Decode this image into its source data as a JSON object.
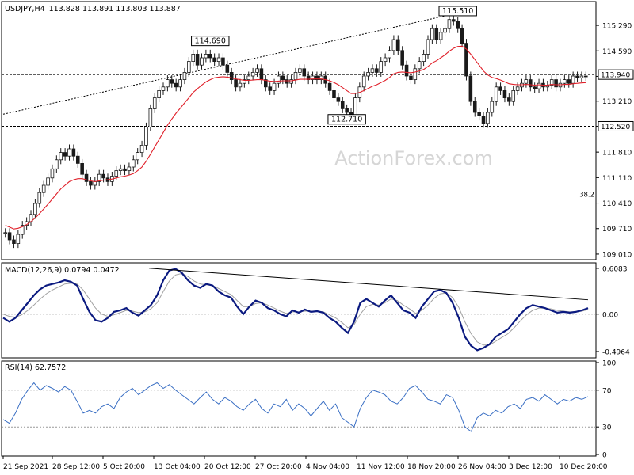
{
  "header": {
    "symbol": "USDJPY,H4",
    "ohlc": "113.828 113.891 113.803 113.887"
  },
  "watermark": "ActionForex.com",
  "colors": {
    "candle": "#1a1a1a",
    "ma": "#e0202a",
    "macd": "#0b1a80",
    "signal": "#a0a0a0",
    "rsi": "#3a6fc4",
    "levels": "#000000",
    "watermark": "#d8d8d8"
  },
  "chart_data": [
    {
      "type": "candlestick",
      "panel": "price",
      "title": "USDJPY,H4",
      "ylim": [
        108.9,
        115.9
      ],
      "y_ticks": [
        "115.290",
        "114.590",
        "113.890",
        "113.210",
        "112.520",
        "111.810",
        "111.110",
        "110.410",
        "109.710",
        "109.010"
      ],
      "y_tick_values": [
        115.29,
        114.59,
        113.89,
        113.21,
        112.52,
        111.81,
        111.11,
        110.41,
        109.71,
        109.01
      ],
      "x_ticks": [
        "21 Sep 2021",
        "28 Sep 12:00",
        "5 Oct 20:00",
        "13 Oct 04:00",
        "20 Oct 12:00",
        "27 Oct 20:00",
        "4 Nov 04:00",
        "11 Nov 12:00",
        "18 Nov 20:00",
        "26 Nov 04:00",
        "3 Dec 12:00",
        "10 Dec 20:00"
      ],
      "close_series": [
        109.6,
        109.4,
        109.3,
        109.55,
        109.8,
        109.9,
        110.1,
        110.4,
        110.7,
        110.9,
        111.1,
        111.35,
        111.6,
        111.8,
        111.7,
        111.9,
        111.7,
        111.5,
        111.2,
        111.0,
        110.9,
        111.0,
        111.2,
        111.1,
        111.0,
        111.15,
        111.3,
        111.35,
        111.3,
        111.4,
        111.6,
        111.8,
        112.0,
        112.5,
        113.0,
        113.3,
        113.5,
        113.6,
        113.8,
        113.7,
        113.6,
        113.8,
        114.0,
        114.3,
        114.5,
        114.2,
        114.4,
        114.5,
        114.4,
        114.3,
        114.4,
        114.2,
        114.0,
        113.8,
        113.6,
        113.7,
        113.8,
        113.9,
        114.0,
        114.1,
        113.8,
        113.6,
        113.5,
        113.7,
        113.9,
        113.8,
        113.7,
        113.8,
        114.0,
        114.1,
        113.9,
        113.8,
        113.9,
        113.8,
        113.9,
        113.7,
        113.5,
        113.3,
        113.2,
        113.0,
        112.9,
        112.75,
        113.3,
        113.6,
        113.9,
        114.0,
        114.1,
        114.0,
        114.3,
        114.4,
        114.6,
        114.9,
        114.6,
        114.2,
        113.9,
        113.8,
        114.1,
        114.3,
        114.5,
        114.9,
        115.2,
        114.9,
        115.1,
        115.2,
        115.45,
        115.4,
        115.2,
        114.8,
        113.9,
        113.2,
        112.9,
        112.8,
        112.6,
        112.9,
        113.2,
        113.6,
        113.5,
        113.3,
        113.2,
        113.5,
        113.6,
        113.7,
        113.8,
        113.6,
        113.55,
        113.7,
        113.6,
        113.65,
        113.8,
        113.6,
        113.7,
        113.8,
        113.7,
        113.9,
        113.85,
        113.9,
        113.887
      ],
      "high_points": [
        {
          "x": "13 Oct 04:00",
          "value": 114.69
        },
        {
          "x": "22 Nov",
          "value": 115.51
        }
      ],
      "low_point": {
        "x": "4 Nov 04:00",
        "value": 112.71
      },
      "moving_average": [
        109.8,
        109.75,
        109.7,
        109.72,
        109.76,
        109.82,
        109.9,
        110.0,
        110.12,
        110.25,
        110.38,
        110.52,
        110.66,
        110.8,
        110.9,
        111.0,
        111.05,
        111.08,
        111.08,
        111.05,
        111.02,
        111.0,
        111.02,
        111.04,
        111.05,
        111.07,
        111.1,
        111.13,
        111.15,
        111.18,
        111.22,
        111.3,
        111.4,
        111.56,
        111.75,
        111.95,
        112.15,
        112.35,
        112.55,
        112.72,
        112.88,
        113.02,
        113.16,
        113.3,
        113.45,
        113.55,
        113.65,
        113.74,
        113.8,
        113.85,
        113.87,
        113.88,
        113.87,
        113.85,
        113.82,
        113.8,
        113.78,
        113.78,
        113.79,
        113.8,
        113.8,
        113.78,
        113.76,
        113.75,
        113.76,
        113.77,
        113.77,
        113.77,
        113.79,
        113.81,
        113.81,
        113.81,
        113.82,
        113.82,
        113.82,
        113.8,
        113.77,
        113.72,
        113.66,
        113.58,
        113.5,
        113.42,
        113.42,
        113.45,
        113.5,
        113.56,
        113.62,
        113.66,
        113.72,
        113.78,
        113.86,
        113.96,
        114.0,
        114.01,
        114.0,
        113.99,
        114.01,
        114.04,
        114.08,
        114.16,
        114.26,
        114.32,
        114.4,
        114.48,
        114.58,
        114.66,
        114.71,
        114.72,
        114.64,
        114.5,
        114.35,
        114.2,
        114.04,
        113.93,
        113.86,
        113.83,
        113.79,
        113.74,
        113.69,
        113.67,
        113.66,
        113.66,
        113.67,
        113.66,
        113.65,
        113.66,
        113.65,
        113.65,
        113.67,
        113.66,
        113.66,
        113.67,
        113.67,
        113.69,
        113.7,
        113.71,
        113.72
      ],
      "horizontal_levels": [
        {
          "value": 113.94,
          "label": "113.940",
          "style": "dashed"
        },
        {
          "value": 112.52,
          "label": "112.520",
          "style": "dashed"
        },
        {
          "value": 110.52,
          "label": "38.2",
          "style": "solid"
        }
      ],
      "trendline": {
        "from": {
          "x": "21 Sep 2021",
          "value": 112.85
        },
        "to": {
          "x": "23 Nov",
          "value": 115.55
        },
        "style": "dotted"
      },
      "labels": [
        "114.690",
        "115.510",
        "112.710",
        "113.940",
        "112.520",
        "38.2"
      ]
    },
    {
      "type": "line",
      "panel": "macd",
      "title": "MACD(12,26,9) 0.0794 0.0472",
      "ylim": [
        -0.56,
        0.66
      ],
      "y_ticks": [
        "0.6083",
        "0.00",
        "-0.4964"
      ],
      "y_tick_values": [
        0.6083,
        0.0,
        -0.4964
      ],
      "series": [
        {
          "name": "MACD",
          "values": [
            -0.05,
            -0.1,
            -0.05,
            0.05,
            0.15,
            0.25,
            0.33,
            0.38,
            0.4,
            0.42,
            0.45,
            0.43,
            0.38,
            0.2,
            0.03,
            -0.08,
            -0.1,
            -0.05,
            0.03,
            0.05,
            0.08,
            0.02,
            -0.02,
            0.05,
            0.12,
            0.25,
            0.45,
            0.58,
            0.6,
            0.55,
            0.45,
            0.38,
            0.35,
            0.4,
            0.38,
            0.3,
            0.25,
            0.22,
            0.1,
            0.0,
            0.1,
            0.18,
            0.15,
            0.08,
            0.05,
            0.0,
            -0.03,
            0.05,
            0.02,
            0.06,
            0.03,
            0.04,
            0.02,
            -0.05,
            -0.1,
            -0.18,
            -0.25,
            -0.1,
            0.15,
            0.2,
            0.15,
            0.1,
            0.18,
            0.25,
            0.15,
            0.05,
            0.02,
            -0.05,
            0.1,
            0.2,
            0.3,
            0.32,
            0.28,
            0.15,
            -0.05,
            -0.3,
            -0.42,
            -0.48,
            -0.45,
            -0.4,
            -0.3,
            -0.25,
            -0.2,
            -0.1,
            0.0,
            0.08,
            0.12,
            0.1,
            0.08,
            0.05,
            0.02,
            0.03,
            0.02,
            0.03,
            0.05,
            0.08
          ]
        },
        {
          "name": "Signal",
          "values": [
            0.0,
            -0.03,
            -0.04,
            -0.01,
            0.05,
            0.12,
            0.2,
            0.27,
            0.32,
            0.36,
            0.4,
            0.41,
            0.4,
            0.32,
            0.2,
            0.08,
            0.0,
            -0.03,
            -0.01,
            0.02,
            0.05,
            0.04,
            0.02,
            0.03,
            0.07,
            0.15,
            0.3,
            0.44,
            0.52,
            0.54,
            0.5,
            0.44,
            0.4,
            0.39,
            0.38,
            0.34,
            0.3,
            0.26,
            0.18,
            0.1,
            0.1,
            0.14,
            0.15,
            0.12,
            0.08,
            0.04,
            0.01,
            0.03,
            0.03,
            0.04,
            0.04,
            0.04,
            0.03,
            -0.01,
            -0.05,
            -0.11,
            -0.18,
            -0.14,
            0.0,
            0.1,
            0.13,
            0.12,
            0.15,
            0.2,
            0.18,
            0.12,
            0.07,
            0.01,
            0.05,
            0.12,
            0.21,
            0.27,
            0.28,
            0.22,
            0.09,
            -0.1,
            -0.26,
            -0.37,
            -0.41,
            -0.41,
            -0.36,
            -0.31,
            -0.26,
            -0.18,
            -0.09,
            -0.01,
            0.05,
            0.08,
            0.08,
            0.07,
            0.05,
            0.04,
            0.03,
            0.03,
            0.04,
            0.06
          ]
        }
      ],
      "trendline": {
        "from": {
          "x": "13 Oct 04:00",
          "value": 0.61
        },
        "to": {
          "x": "10 Dec 20:00",
          "value": 0.19
        }
      }
    },
    {
      "type": "line",
      "panel": "rsi",
      "title": "RSI(14) 62.7572",
      "ylim": [
        0,
        100
      ],
      "y_ticks": [
        "100",
        "70",
        "30",
        "0"
      ],
      "y_tick_values": [
        100,
        70,
        30,
        0
      ],
      "levels": [
        70,
        30
      ],
      "series": [
        {
          "name": "RSI",
          "values": [
            38,
            34,
            45,
            60,
            70,
            78,
            70,
            75,
            72,
            68,
            74,
            70,
            58,
            45,
            48,
            45,
            52,
            55,
            50,
            62,
            68,
            72,
            65,
            70,
            75,
            78,
            72,
            76,
            70,
            65,
            60,
            55,
            62,
            68,
            60,
            55,
            62,
            58,
            52,
            48,
            55,
            60,
            50,
            45,
            55,
            52,
            60,
            48,
            55,
            50,
            42,
            50,
            58,
            48,
            55,
            40,
            35,
            30,
            50,
            62,
            70,
            68,
            65,
            58,
            55,
            62,
            72,
            75,
            68,
            60,
            58,
            55,
            65,
            62,
            48,
            30,
            25,
            40,
            45,
            42,
            48,
            45,
            52,
            55,
            50,
            60,
            62,
            58,
            65,
            60,
            55,
            60,
            58,
            62,
            60,
            63
          ]
        }
      ]
    }
  ]
}
